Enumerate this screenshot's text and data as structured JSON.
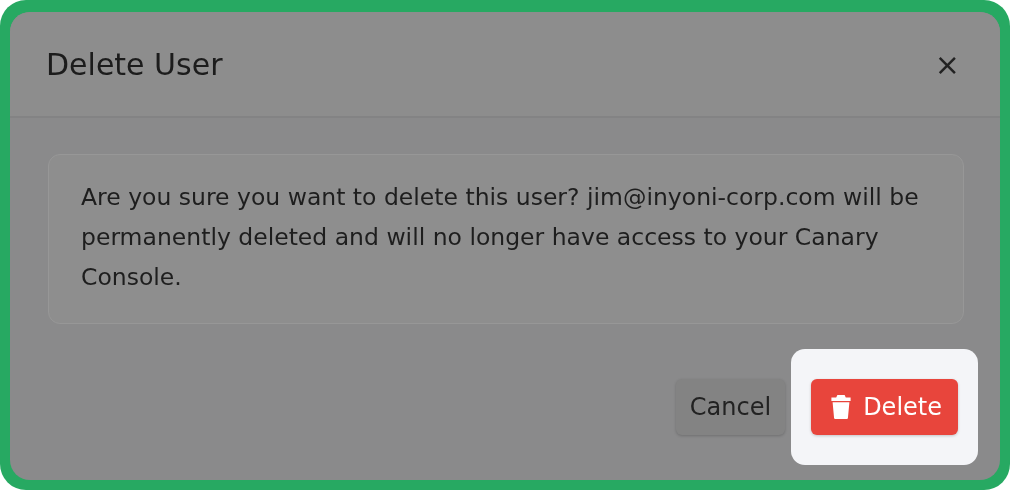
{
  "dialog": {
    "title": "Delete User",
    "close_label": "×"
  },
  "message": "Are you sure you want to delete this user? jim@inyoni-corp.com will be permanently deleted and will no longer have access to your Canary Console.",
  "buttons": [
    {
      "label": "Cancel",
      "kind": "secondary",
      "highlighted": false
    },
    {
      "label": "Delete",
      "kind": "danger",
      "highlighted": true
    }
  ]
}
